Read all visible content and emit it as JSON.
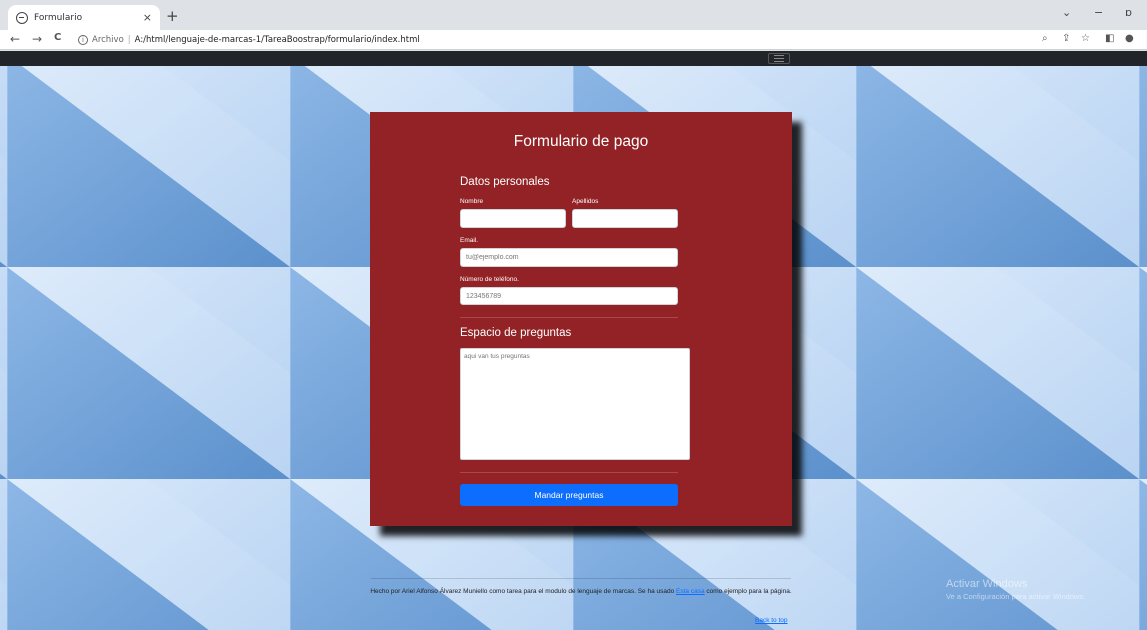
{
  "browser": {
    "tab_title": "Formulario",
    "tab_close": "×",
    "new_tab": "+",
    "url_prefix": "Archivo",
    "url_separator": "|",
    "url": "A:/html/lenguaje-de-marcas-1/TareaBoostrap/formulario/index.html",
    "nav_back": "←",
    "nav_forward": "→",
    "nav_reload": "C",
    "info_glyph": "i",
    "win_menu": "⌄",
    "win_minimize": "−",
    "win_restore": "ɒ",
    "tool_zoom": "⌕",
    "tool_share": "⇪",
    "tool_star": "☆",
    "tool_sidepanel": "◧",
    "tool_profile": "●"
  },
  "form": {
    "title": "Formulario de pago",
    "section_personal": "Datos personales",
    "label_nombre": "Nombre",
    "label_apellidos": "Apellidos",
    "value_nombre": "",
    "value_apellidos": "",
    "label_email": "Email.",
    "placeholder_email": "tu@ejemplo.com",
    "label_phone": "Número de teléfono.",
    "placeholder_phone": "123456789",
    "section_questions": "Espacio de preguntas",
    "placeholder_questions": "aqui van tus preguntas",
    "submit_label": "Mandar preguntas"
  },
  "footer": {
    "text_before": "Hecho por Ariel Alfonso Álvarez Muniello como tarea para el modulo de lenguaje de marcas. Se ha usado ",
    "link_text": "Esta casa",
    "text_after": " como ejemplo para la página.",
    "back_to_top": "Back to top"
  },
  "watermark": {
    "title": "Activar Windows",
    "subtitle": "Ve a Configuración para activar Windows."
  },
  "colors": {
    "card": "#922225",
    "button": "#0d6efd",
    "navbar": "#212529",
    "background_light": "#c5dcf6",
    "background_dark": "#6a9dd6"
  }
}
